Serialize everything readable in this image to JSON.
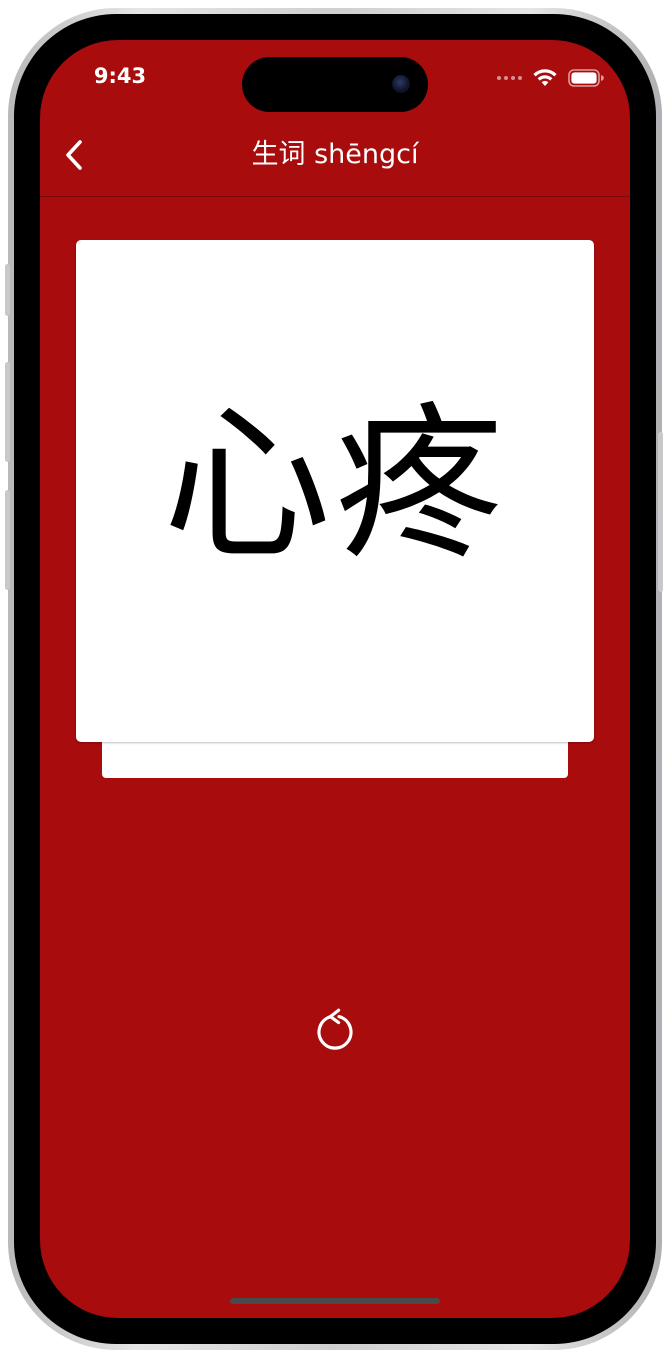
{
  "status_bar": {
    "time": "9:43",
    "icons": [
      "cellular-icon",
      "wifi-icon",
      "battery-icon"
    ]
  },
  "navbar": {
    "title": "生词 shēngcí",
    "back_icon": "chevron-left-icon"
  },
  "flashcard": {
    "word": "心疼"
  },
  "controls": {
    "flip_icon": "rotate-ccw-icon"
  },
  "colors": {
    "background": "#a80c0c",
    "card": "#ffffff",
    "text_on_bg": "#ffffff",
    "card_text": "#000000"
  }
}
